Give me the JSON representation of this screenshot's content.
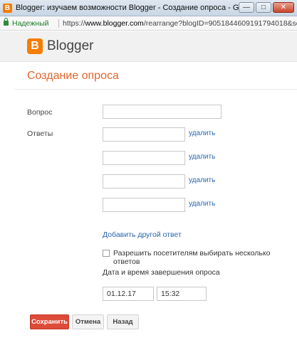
{
  "window": {
    "title": "Blogger: изучаем возможности Blogger - Создание опроса - Google Chrome",
    "app_icon": "blogger-icon",
    "minimize_glyph": "—",
    "maximize_glyph": "□",
    "close_glyph": "✕"
  },
  "address_bar": {
    "secure_label": "Надежный",
    "url_scheme": "https://",
    "url_host": "www.blogger.com",
    "url_rest": "/rearrange?blogID=905184460919179401​8&sectionI..."
  },
  "header": {
    "brand_name": "Blogger",
    "logo_icon": "blogger-logo-icon"
  },
  "form": {
    "title": "Создание опроса",
    "question_label": "Вопрос",
    "question_value": "",
    "answers_label": "Ответы",
    "answers": [
      {
        "value": "",
        "delete_label": "удалить"
      },
      {
        "value": "",
        "delete_label": "удалить"
      },
      {
        "value": "",
        "delete_label": "удалить"
      },
      {
        "value": "",
        "delete_label": "удалить"
      }
    ],
    "add_answer_label": "Добавить другой ответ",
    "multiple_answers_label": "Разрешить посетителям выбирать несколько ответов",
    "multiple_answers_checked": false,
    "deadline_label": "Дата и время завершения опроса",
    "deadline_date": "01.12.17",
    "deadline_time": "15:32"
  },
  "actions": {
    "save_label": "Сохранить",
    "cancel_label": "Отмена",
    "back_label": "Назад"
  },
  "colors": {
    "accent": "#e3662d",
    "primary_button": "#dd4b39",
    "link": "#2a64b0",
    "brand": "#f57d00"
  }
}
